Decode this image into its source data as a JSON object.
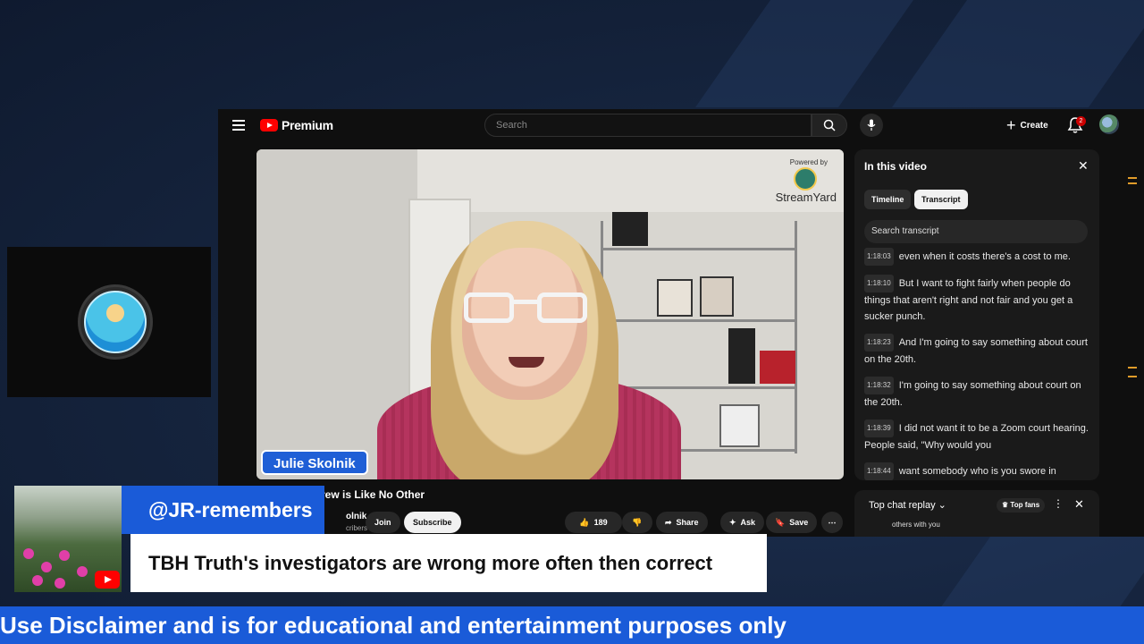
{
  "youtube": {
    "logo_text": "Premium",
    "search_placeholder": "Search",
    "create_label": "Create",
    "notification_count": "2"
  },
  "video": {
    "watermark_powered": "Powered by",
    "watermark_brand": "StreamYard",
    "name_tag": "Julie Skolnik",
    "title_visible": "rew is Like No Other",
    "channel_visible": "olnik",
    "subs_visible": "cribers",
    "join_label": "Join",
    "subscribe_label": "Subscribe",
    "likes": "189",
    "share_label": "Share",
    "ask_label": "Ask",
    "save_label": "Save"
  },
  "panel": {
    "title": "In this video",
    "tabs": [
      "Timeline",
      "Transcript"
    ],
    "active_tab": "Transcript",
    "search_placeholder": "Search transcript",
    "segments": [
      {
        "time": "1:18:03",
        "text": "even when it costs there's a cost to me."
      },
      {
        "time": "1:18:10",
        "text": "But I want to fight fairly when people do things that aren't right and not fair and you get a sucker punch."
      },
      {
        "time": "1:18:23",
        "text": "And I'm going to say something about court on the 20th."
      },
      {
        "time": "1:18:32",
        "text": "I'm going to say something about court on the 20th."
      },
      {
        "time": "1:18:39",
        "text": "I did not want it to be a Zoom court hearing. People said, \"Why would you"
      },
      {
        "time": "1:18:44",
        "text": "want somebody who is you swore in"
      }
    ]
  },
  "chat": {
    "label": "Top chat replay",
    "fans_label": "Top fans",
    "message_preview": "others with you"
  },
  "overlay": {
    "handle": "@JR-remembers",
    "quote": "TBH Truth's investigators are wrong more often then correct",
    "ticker": "Use Disclaimer and is for educational and entertainment purposes only"
  },
  "colors": {
    "accent_blue": "#1a5bd8",
    "youtube_red": "#ff0000",
    "panel_bg": "#1a1a1a"
  }
}
